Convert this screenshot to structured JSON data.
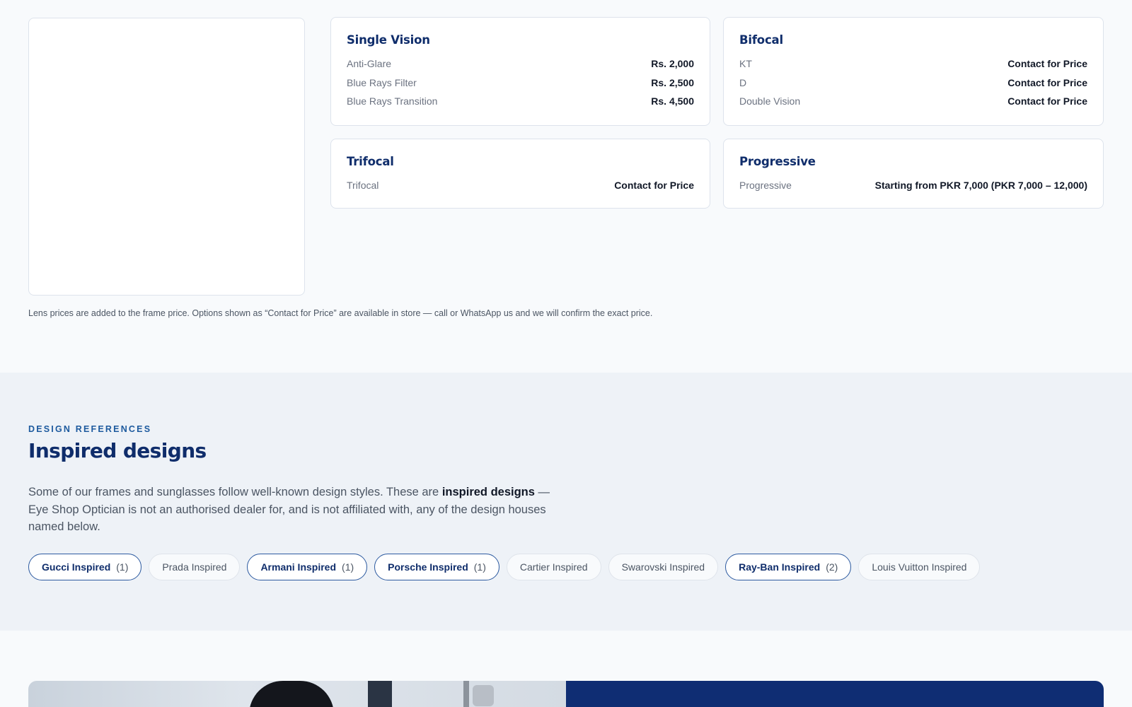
{
  "lens_pricing": {
    "cards": [
      {
        "title": "Single Vision",
        "rows": [
          {
            "option": "Anti-Glare",
            "price": "Rs. 2,000"
          },
          {
            "option": "Blue Rays Filter",
            "price": "Rs. 2,500"
          },
          {
            "option": "Blue Rays Transition",
            "price": "Rs. 4,500"
          }
        ]
      },
      {
        "title": "Bifocal",
        "rows": [
          {
            "option": "KT",
            "price": "Contact for Price"
          },
          {
            "option": "D",
            "price": "Contact for Price"
          },
          {
            "option": "Double Vision",
            "price": "Contact for Price"
          }
        ]
      },
      {
        "title": "Trifocal",
        "rows": [
          {
            "option": "Trifocal",
            "price": "Contact for Price"
          }
        ]
      },
      {
        "title": "Progressive",
        "rows": [
          {
            "option": "Progressive",
            "price": "Starting from PKR 7,000 (PKR 7,000 – 12,000)"
          }
        ]
      }
    ],
    "note": "Lens prices are added to the frame price. Options shown as “Contact for Price” are available in store — call or WhatsApp us and we will confirm the exact price."
  },
  "inspired": {
    "eyebrow": "DESIGN REFERENCES",
    "title": "Inspired designs",
    "desc_before": "Some of our frames and sunglasses follow well-known design styles. These are ",
    "desc_bold": "inspired designs",
    "desc_after": " — Eye Shop Optician is not an authorised dealer for, and is not affiliated with, any of the design houses named below.",
    "chips": [
      {
        "label": "Gucci Inspired",
        "count": "(1)",
        "active": true
      },
      {
        "label": "Prada Inspired",
        "count": "",
        "active": false
      },
      {
        "label": "Armani Inspired",
        "count": "(1)",
        "active": true
      },
      {
        "label": "Porsche Inspired",
        "count": "(1)",
        "active": true
      },
      {
        "label": "Cartier Inspired",
        "count": "",
        "active": false
      },
      {
        "label": "Swarovski Inspired",
        "count": "",
        "active": false
      },
      {
        "label": "Ray-Ban Inspired",
        "count": "(2)",
        "active": true
      },
      {
        "label": "Louis Vuitton Inspired",
        "count": "",
        "active": false
      }
    ]
  },
  "colors": {
    "brand_navy": "#0f2d6b",
    "accent_blue": "#1d5a9e",
    "banner_navy": "#0f2d73",
    "section_bg": "#eef2f7"
  }
}
